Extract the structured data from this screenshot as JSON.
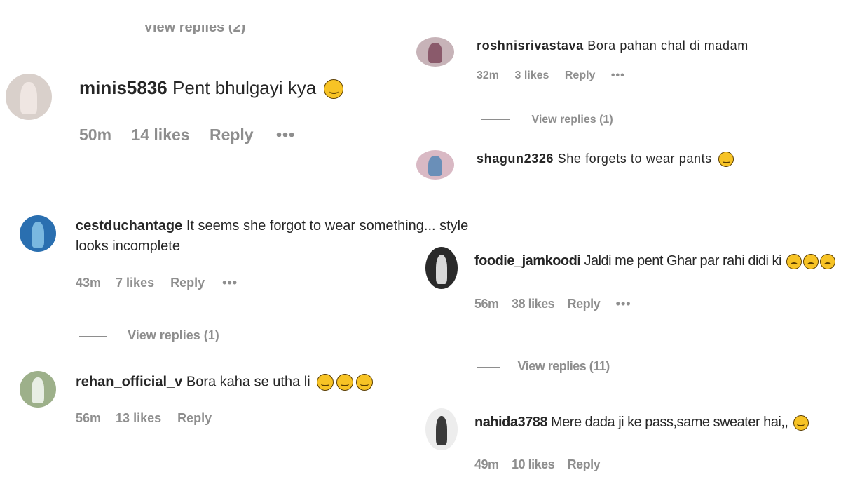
{
  "left": {
    "cut_view_replies": "View replies (2)",
    "c1": {
      "username": "minis5836",
      "text": "Pent bhulgayi kya",
      "time": "50m",
      "likes": "14 likes",
      "reply": "Reply",
      "more": "•••"
    },
    "c2": {
      "username": "cestduchantage",
      "text": "It seems she forgot to wear something... style",
      "text2": "looks incomplete",
      "time": "43m",
      "likes": "7 likes",
      "reply": "Reply",
      "more": "•••",
      "view_replies": "View replies (1)"
    },
    "c3": {
      "username": "rehan_official_v",
      "text": "Bora kaha se utha li",
      "time": "56m",
      "likes": "13 likes",
      "reply": "Reply"
    }
  },
  "right": {
    "c1": {
      "username": "roshnisrivastava",
      "text": "Bora pahan chal di madam",
      "time": "32m",
      "likes": "3 likes",
      "reply": "Reply",
      "more": "•••",
      "view_replies": "View replies (1)"
    },
    "c2": {
      "username": "shagun2326",
      "text": "She forgets to wear pants"
    },
    "c3": {
      "username": "foodie_jamkoodi",
      "text": "Jaldi me pent Ghar par rahi didi ki",
      "time": "56m",
      "likes": "38 likes",
      "reply": "Reply",
      "more": "•••",
      "view_replies": "View replies (11)"
    },
    "c4": {
      "username": "nahida3788",
      "text": "Mere dada ji ke pass,same sweater hai,,",
      "time": "49m",
      "likes": "10 likes",
      "reply": "Reply"
    }
  },
  "colors": {
    "text": "#262626",
    "meta": "#8e8e8e",
    "emoji": "#f7c325"
  }
}
